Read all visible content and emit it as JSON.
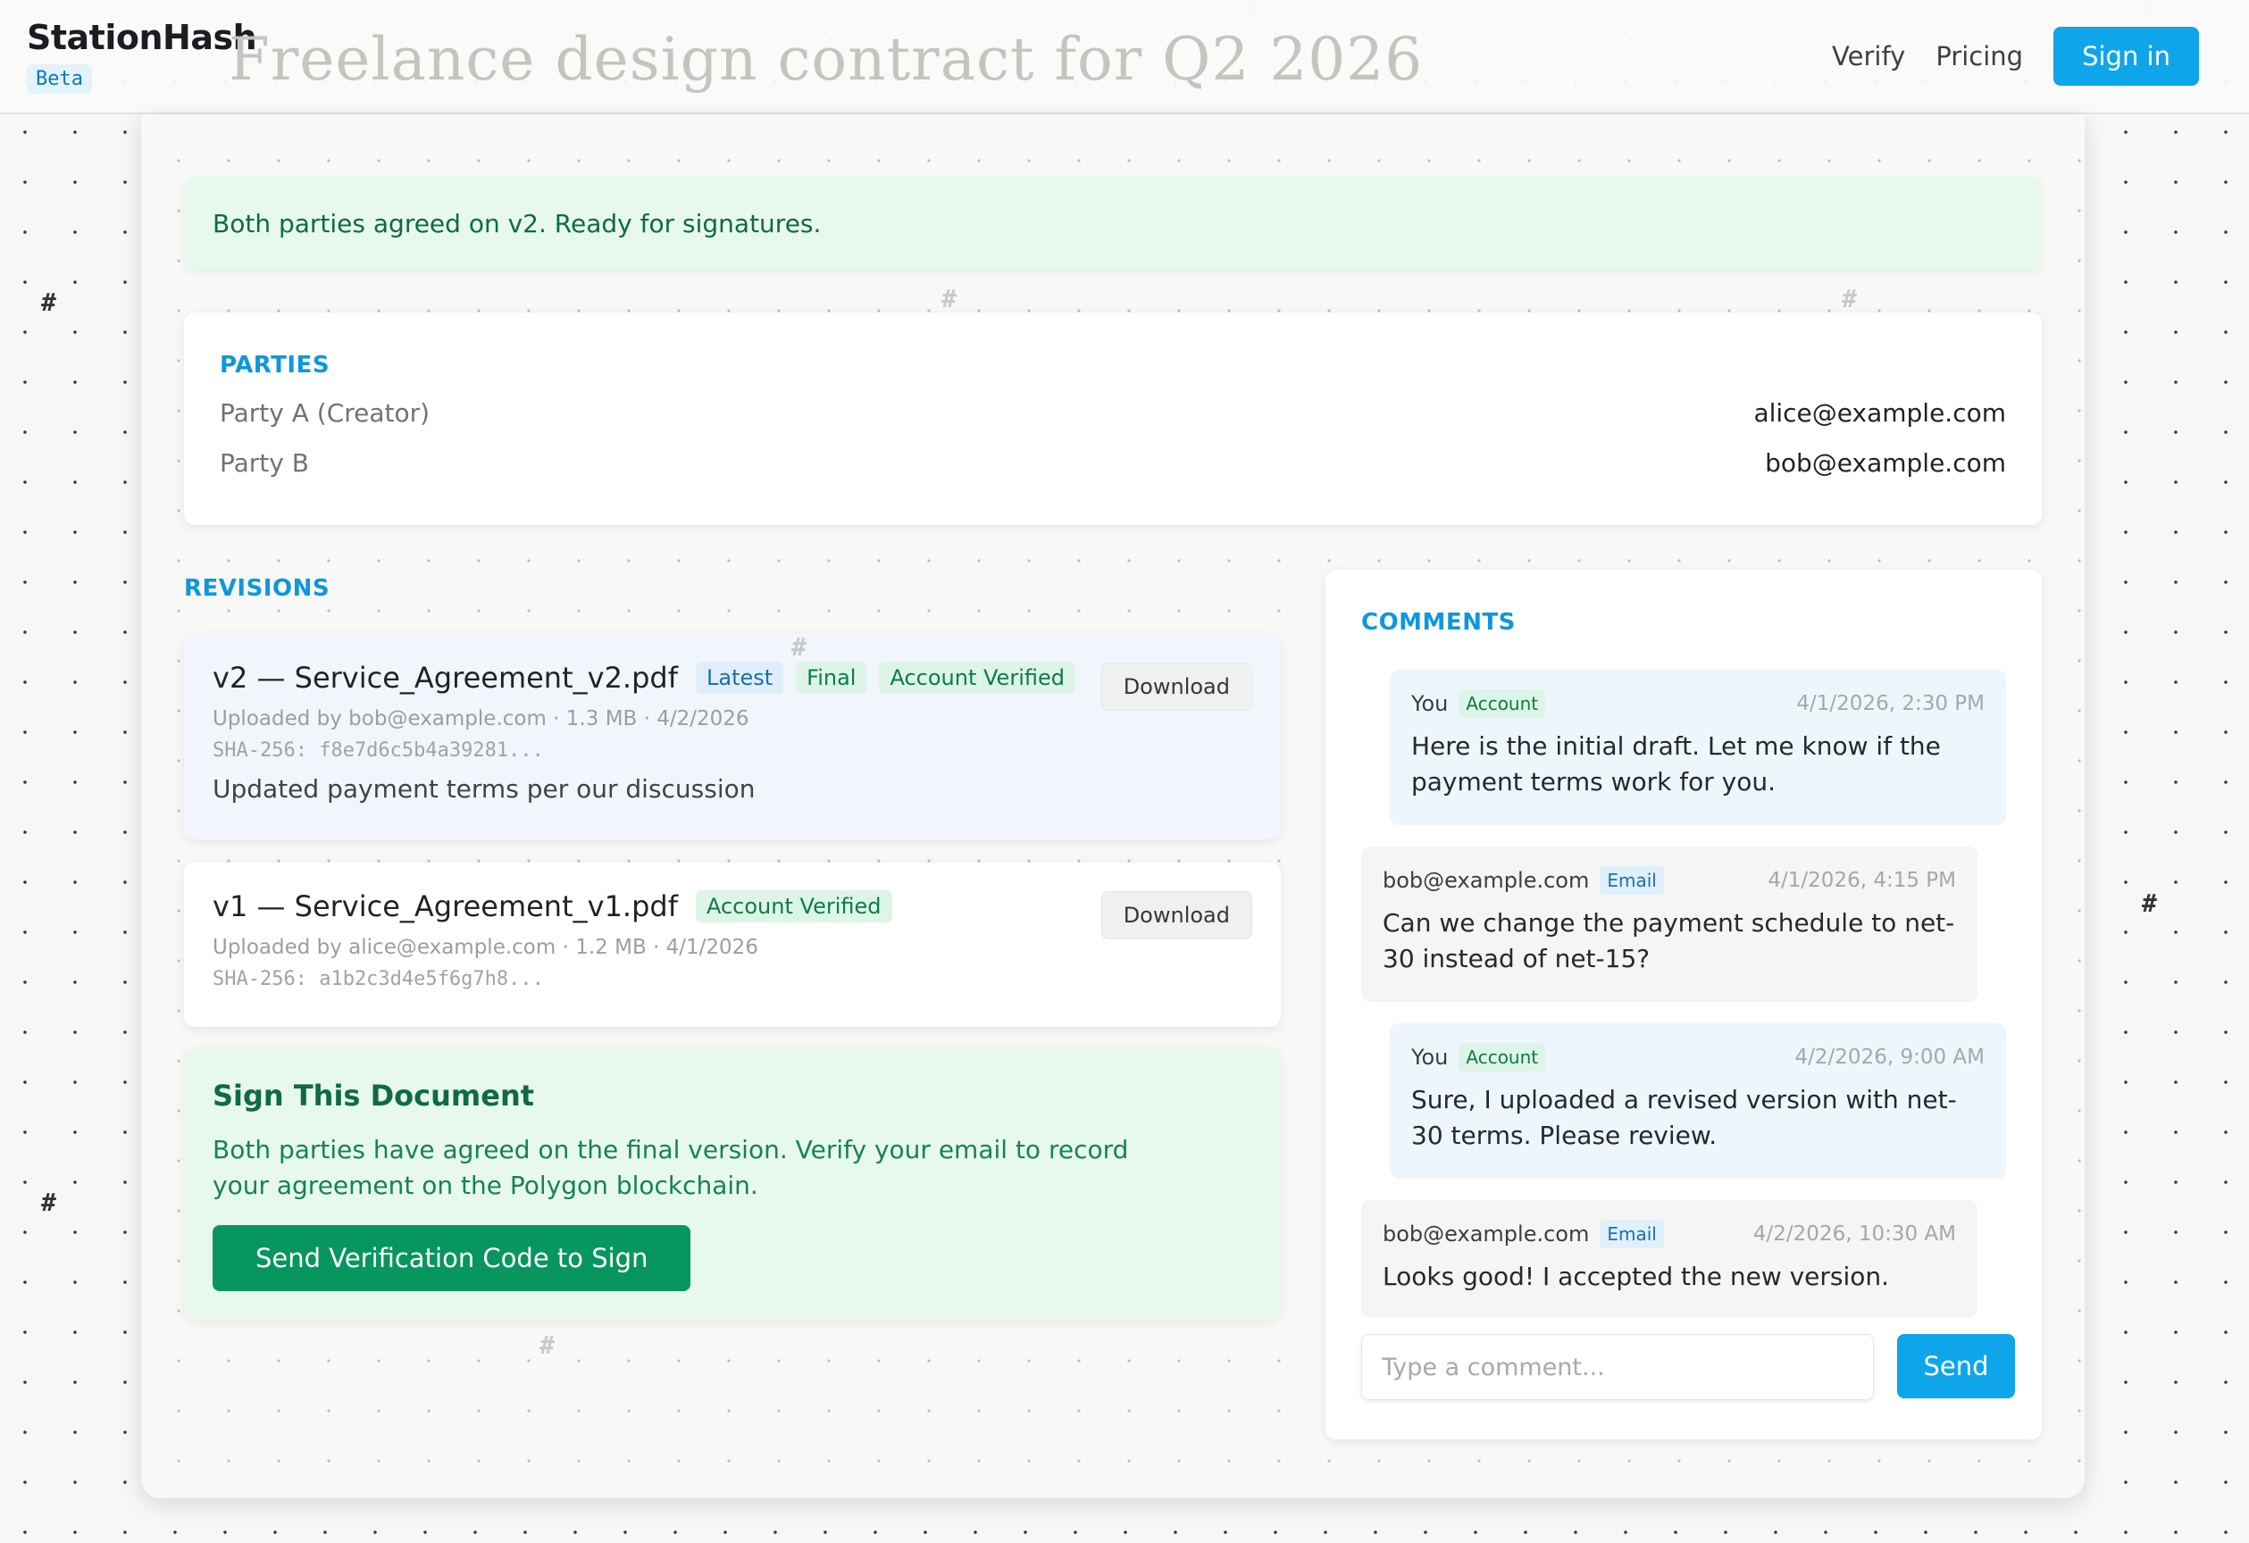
{
  "header": {
    "brand": "StationHash",
    "badge": "Beta",
    "document_title": "Freelance design contract for Q2 2026",
    "nav": {
      "verify": "Verify",
      "pricing": "Pricing",
      "sign_in": "Sign in"
    }
  },
  "banner": {
    "text": "Both parties agreed on v2. Ready for signatures."
  },
  "parties": {
    "title": "PARTIES",
    "items": [
      {
        "label": "Party A (Creator)",
        "email": "alice@example.com"
      },
      {
        "label": "Party B",
        "email": "bob@example.com"
      }
    ]
  },
  "revisions": {
    "title": "REVISIONS",
    "items": [
      {
        "name": "v2 — Service_Agreement_v2.pdf",
        "tags": [
          "Latest",
          "Final",
          "Account Verified"
        ],
        "meta": "Uploaded by bob@example.com · 1.3 MB · 4/2/2026",
        "hash": "SHA-256:  f8e7d6c5b4a39281...",
        "note": "Updated payment terms per our discussion",
        "download": "Download"
      },
      {
        "name": "v1 — Service_Agreement_v1.pdf",
        "tags": [
          "Account Verified"
        ],
        "meta": "Uploaded by alice@example.com · 1.2 MB · 4/1/2026",
        "hash": "SHA-256:  a1b2c3d4e5f6g7h8...",
        "download": "Download"
      }
    ]
  },
  "sign": {
    "title": "Sign This Document",
    "text": "Both parties have agreed on the final version. Verify your email to record your agreement on the Polygon blockchain.",
    "button": "Send Verification Code to Sign"
  },
  "comments": {
    "title": "COMMENTS",
    "items": [
      {
        "author": "You",
        "badge": "Account",
        "time": "4/1/2026, 2:30 PM",
        "text": "Here is the initial draft. Let me know if the payment terms work for you."
      },
      {
        "author": "bob@example.com",
        "badge": "Email",
        "time": "4/1/2026, 4:15 PM",
        "text": "Can we change the payment schedule to net-30 instead of net-15?"
      },
      {
        "author": "You",
        "badge": "Account",
        "time": "4/2/2026, 9:00 AM",
        "text": "Sure, I uploaded a revised version with net-30 terms. Please review."
      },
      {
        "author": "bob@example.com",
        "badge": "Email",
        "time": "4/2/2026, 10:30 AM",
        "text": "Looks good! I accepted the new version."
      }
    ],
    "input_placeholder": "Type a comment...",
    "send": "Send"
  },
  "colors": {
    "accent": "#0ea5ea",
    "success": "#079660",
    "success_bg": "#e7f8ef",
    "page_bg": "#f7f7f5"
  }
}
